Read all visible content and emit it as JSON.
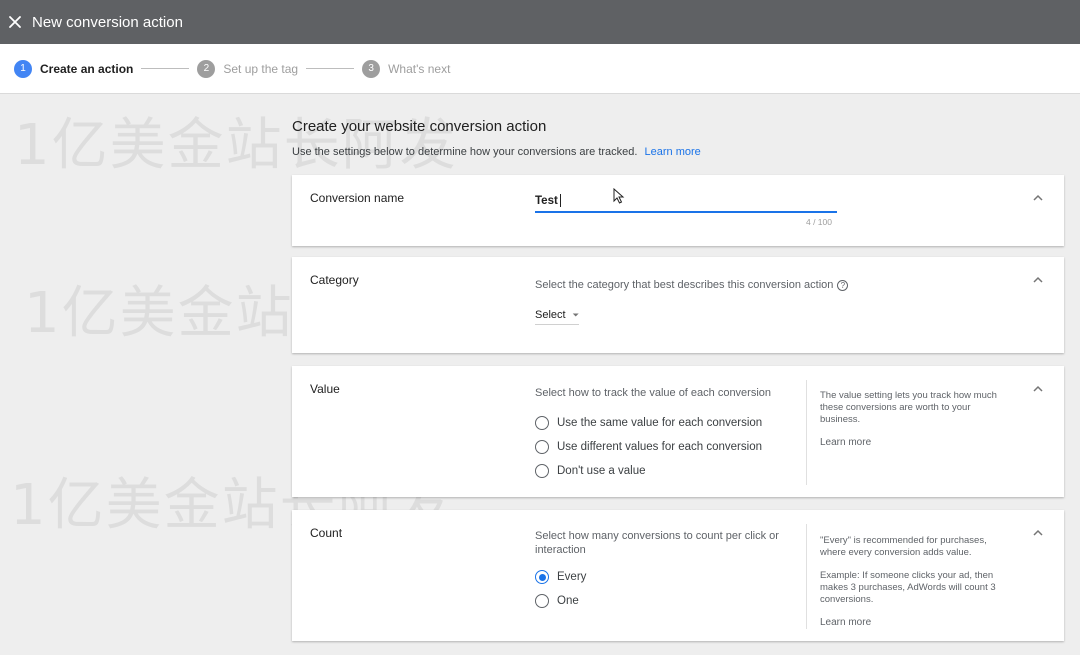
{
  "header": {
    "title": "New conversion action"
  },
  "steps": [
    {
      "num": "1",
      "label": "Create an action"
    },
    {
      "num": "2",
      "label": "Set up the tag"
    },
    {
      "num": "3",
      "label": "What's next"
    }
  ],
  "page": {
    "title": "Create your website conversion action",
    "subtitle": "Use the settings below to determine how your conversions are tracked.",
    "learn_more": "Learn more"
  },
  "conversion_name": {
    "label": "Conversion name",
    "value": "Test",
    "counter": "4 / 100"
  },
  "category": {
    "label": "Category",
    "prompt": "Select the category that best describes this conversion action",
    "help_icon": "?",
    "select_value": "Select"
  },
  "value": {
    "label": "Value",
    "prompt": "Select how to track the value of each conversion",
    "options": [
      "Use the same value for each conversion",
      "Use different values for each conversion",
      "Don't use a value"
    ],
    "note": "The value setting lets you track how much these conversions are worth to your business.",
    "learn_more": "Learn more"
  },
  "count": {
    "label": "Count",
    "prompt": "Select how many conversions to count per click or interaction",
    "options": [
      "Every",
      "One"
    ],
    "note1": "\"Every\" is recommended for purchases, where every conversion adds value.",
    "note2": "Example: If someone clicks your ad, then makes 3 purchases, AdWords will count 3 conversions.",
    "learn_more": "Learn more"
  },
  "watermark": "1亿美金站长阿发",
  "colors": {
    "header": "#5f6164",
    "accent": "#1a73e8",
    "step_active": "#4285f4"
  }
}
